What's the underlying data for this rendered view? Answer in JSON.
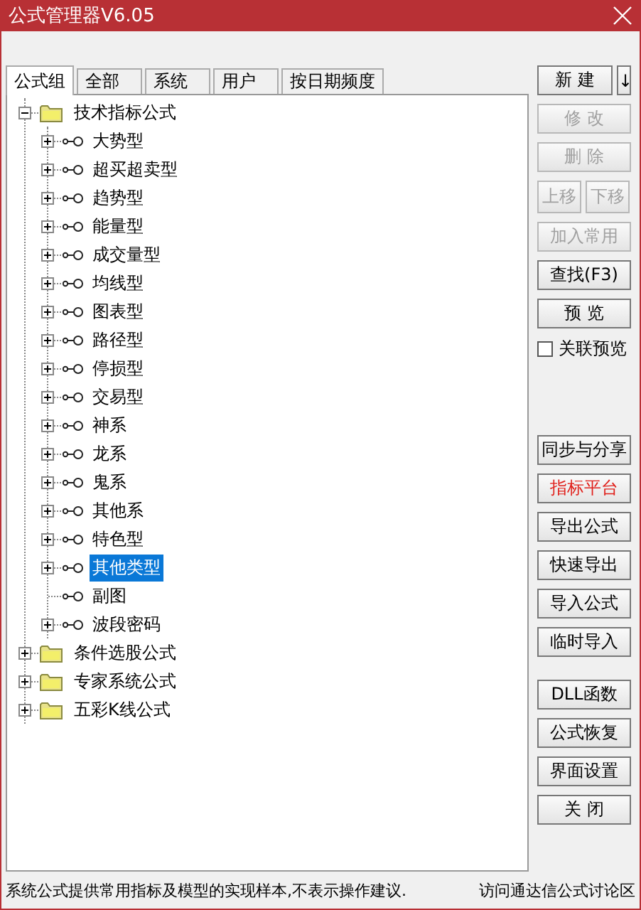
{
  "window": {
    "title": "公式管理器V6.05"
  },
  "tabs": [
    {
      "label": "公式组",
      "selected": true
    },
    {
      "label": "全部",
      "selected": false
    },
    {
      "label": "系统",
      "selected": false
    },
    {
      "label": "用户",
      "selected": false
    },
    {
      "label": "按日期频度",
      "selected": false
    }
  ],
  "tree": [
    {
      "label": "技术指标公式",
      "expanded": true,
      "selected": false,
      "children": [
        {
          "label": "大势型",
          "kind": "branch",
          "selected": false
        },
        {
          "label": "超买超卖型",
          "kind": "branch",
          "selected": false
        },
        {
          "label": "趋势型",
          "kind": "branch",
          "selected": false
        },
        {
          "label": "能量型",
          "kind": "branch",
          "selected": false
        },
        {
          "label": "成交量型",
          "kind": "branch",
          "selected": false
        },
        {
          "label": "均线型",
          "kind": "branch",
          "selected": false
        },
        {
          "label": "图表型",
          "kind": "branch",
          "selected": false
        },
        {
          "label": "路径型",
          "kind": "branch",
          "selected": false
        },
        {
          "label": "停损型",
          "kind": "branch",
          "selected": false
        },
        {
          "label": "交易型",
          "kind": "branch",
          "selected": false
        },
        {
          "label": "神系",
          "kind": "branch",
          "selected": false
        },
        {
          "label": "龙系",
          "kind": "branch",
          "selected": false
        },
        {
          "label": "鬼系",
          "kind": "branch",
          "selected": false
        },
        {
          "label": "其他系",
          "kind": "branch",
          "selected": false
        },
        {
          "label": "特色型",
          "kind": "branch",
          "selected": false
        },
        {
          "label": "其他类型",
          "kind": "branch",
          "selected": true
        },
        {
          "label": "副图",
          "kind": "leaf",
          "selected": false
        },
        {
          "label": "波段密码",
          "kind": "branch",
          "selected": false
        }
      ]
    },
    {
      "label": "条件选股公式",
      "expanded": false,
      "selected": false
    },
    {
      "label": "专家系统公式",
      "expanded": false,
      "selected": false
    },
    {
      "label": "五彩K线公式",
      "expanded": false,
      "selected": false
    }
  ],
  "actions_top": [
    [
      {
        "label": "新 建",
        "disabled": false,
        "kind": "wide"
      },
      {
        "label": "↓",
        "disabled": false,
        "kind": "arrow"
      }
    ],
    [
      {
        "label": "修 改",
        "disabled": true,
        "kind": "full"
      }
    ],
    [
      {
        "label": "删 除",
        "disabled": true,
        "kind": "full"
      }
    ],
    [
      {
        "label": "上移",
        "disabled": true,
        "kind": "half"
      },
      {
        "label": "下移",
        "disabled": true,
        "kind": "half"
      }
    ],
    [
      {
        "label": "加入常用",
        "disabled": true,
        "kind": "full"
      }
    ],
    [
      {
        "label": "查找(F3)",
        "disabled": false,
        "kind": "full"
      }
    ],
    [
      {
        "label": "预 览",
        "disabled": false,
        "kind": "full"
      }
    ]
  ],
  "preview_link": {
    "label": "关联预览",
    "checked": false
  },
  "actions_middle": [
    {
      "label": "同步与分享",
      "kind": "normal"
    },
    {
      "label": "指标平台",
      "kind": "accent"
    },
    {
      "label": "导出公式",
      "kind": "normal"
    },
    {
      "label": "快速导出",
      "kind": "normal"
    },
    {
      "label": "导入公式",
      "kind": "normal"
    },
    {
      "label": "临时导入",
      "kind": "normal"
    }
  ],
  "actions_bottom": [
    {
      "label": "DLL函数"
    },
    {
      "label": "公式恢复"
    },
    {
      "label": "界面设置"
    },
    {
      "label": "关 闭"
    }
  ],
  "status_bar": {
    "note": "系统公式提供常用指标及模型的实现样本,不表示操作建议.",
    "link": "访问通达信公式讨论区"
  }
}
